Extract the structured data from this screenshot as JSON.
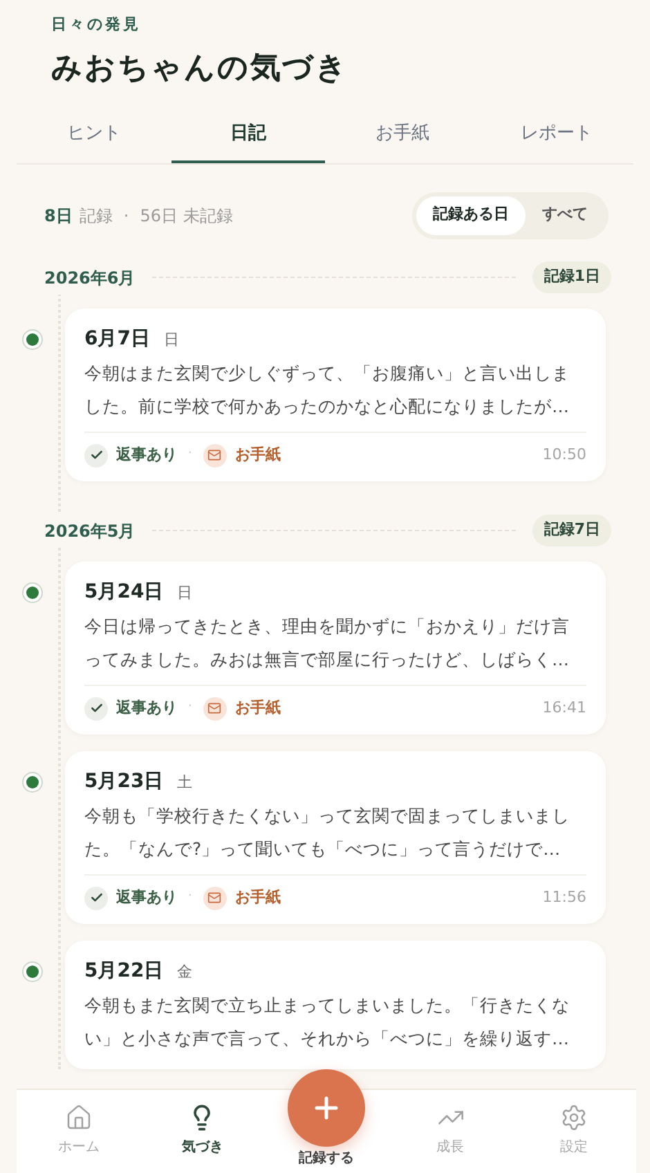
{
  "header": {
    "eyebrow": "日々の発見",
    "title": "みおちゃんの気づき"
  },
  "tabs": [
    {
      "label": "ヒント",
      "selected": false
    },
    {
      "label": "日記",
      "selected": true
    },
    {
      "label": "お手紙",
      "selected": false
    },
    {
      "label": "レポート",
      "selected": false
    }
  ],
  "summary": {
    "recorded_count": "8日",
    "recorded_label": "記録",
    "separator": "·",
    "unrecorded": "56日 未記録"
  },
  "filter": [
    {
      "label": "記録ある日",
      "selected": true
    },
    {
      "label": "すべて",
      "selected": false
    }
  ],
  "months": [
    {
      "title": "2026年6月",
      "badge": "記録1日",
      "entries": [
        {
          "date": "6月7日",
          "weekday": "日",
          "text": "今朝はまた玄関で少しぐずって、「お腹痛い」と言い出しました。前に学校で何かあったのかなと心配になりましたが…",
          "reply": "返事あり",
          "separator": "·",
          "letter": "お手紙",
          "time": "10:50"
        }
      ]
    },
    {
      "title": "2026年5月",
      "badge": "記録7日",
      "entries": [
        {
          "date": "5月24日",
          "weekday": "日",
          "text": "今日は帰ってきたとき、理由を聞かずに「おかえり」だけ言ってみました。みおは無言で部屋に行ったけど、しばらく…",
          "reply": "返事あり",
          "separator": "·",
          "letter": "お手紙",
          "time": "16:41"
        },
        {
          "date": "5月23日",
          "weekday": "土",
          "text": "今朝も「学校行きたくない」って玄関で固まってしまいました。「なんで?」って聞いても「べつに」って言うだけで…",
          "reply": "返事あり",
          "separator": "·",
          "letter": "お手紙",
          "time": "11:56"
        },
        {
          "date": "5月22日",
          "weekday": "金",
          "text": "今朝もまた玄関で立ち止まってしまいました。「行きたくない」と小さな声で言って、それから「べつに」を繰り返す…"
        }
      ]
    }
  ],
  "nav": [
    {
      "label": "ホーム",
      "kind": "tab",
      "selected": false
    },
    {
      "label": "気づき",
      "kind": "tab",
      "selected": true
    },
    {
      "label": "記録する",
      "kind": "fab"
    },
    {
      "label": "成長",
      "kind": "tab",
      "selected": false
    },
    {
      "label": "設定",
      "kind": "tab",
      "selected": false
    }
  ]
}
